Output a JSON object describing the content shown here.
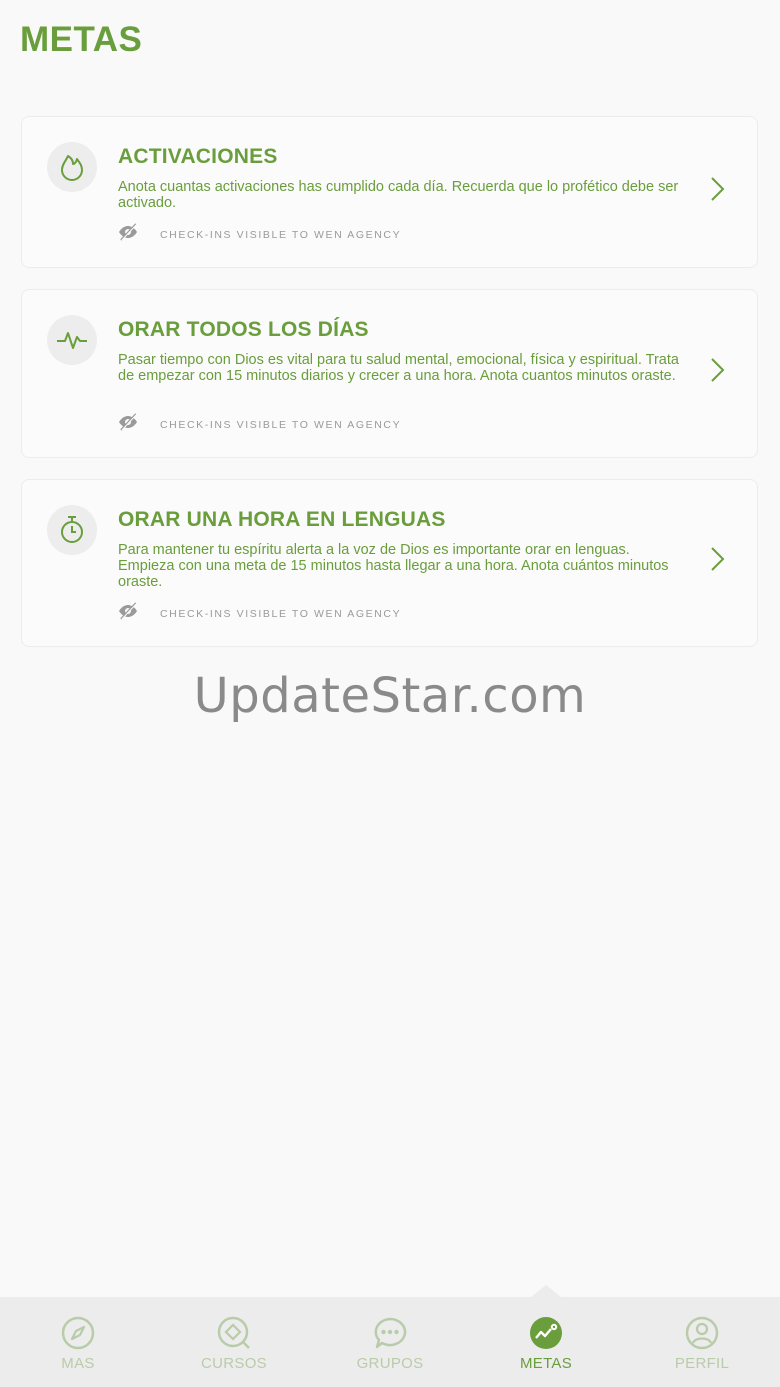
{
  "header": {
    "title": "METAS"
  },
  "cards": [
    {
      "title": "ACTIVACIONES",
      "description": "Anota cuantas activaciones has cumplido cada día. Recuerda que lo profético debe ser activado.",
      "checkin_label": "CHECK-INS VISIBLE TO WEN AGENCY",
      "icon": "flame-icon"
    },
    {
      "title": "ORAR TODOS LOS DÍAS",
      "description": "Pasar tiempo con Dios es vital para tu salud mental, emocional, física y espiritual. Trata de empezar con 15 minutos diarios y crecer a una hora. Anota cuantos minutos oraste.",
      "checkin_label": "CHECK-INS VISIBLE TO WEN AGENCY",
      "icon": "pulse-icon"
    },
    {
      "title": "ORAR UNA HORA EN LENGUAS",
      "description": "Para mantener tu espíritu alerta a la voz de Dios es importante orar en lenguas. Empieza con una meta de 15 minutos hasta llegar a una hora. Anota cuántos minutos oraste.",
      "checkin_label": "CHECK-INS VISIBLE TO WEN AGENCY",
      "icon": "stopwatch-icon"
    }
  ],
  "watermark": "UpdateStar.com",
  "tabbar": {
    "tabs": [
      {
        "label": "MAS",
        "icon": "compass-icon"
      },
      {
        "label": "CURSOS",
        "icon": "courses-icon"
      },
      {
        "label": "GRUPOS",
        "icon": "chat-icon"
      },
      {
        "label": "METAS",
        "icon": "goals-icon",
        "active": true
      },
      {
        "label": "PERFIL",
        "icon": "profile-icon"
      }
    ]
  },
  "colors": {
    "accent": "#6a9e3c",
    "inactive_tab": "#b9ccaa",
    "muted_text": "#9a9a9a",
    "background": "#f9f9f9"
  }
}
